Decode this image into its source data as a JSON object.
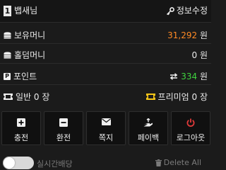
{
  "user": {
    "level": "1",
    "name": "뱁새님",
    "edit_label": "정보수정"
  },
  "balances": [
    {
      "key": "money",
      "label": "보유머니",
      "value": "31,292",
      "unit": "원",
      "icon": "coins-icon"
    },
    {
      "key": "hold",
      "label": "홀덤머니",
      "value": "0",
      "unit": "원",
      "icon": "coins-icon"
    },
    {
      "key": "point",
      "label": "포인트",
      "value": "334",
      "unit": "원",
      "icon": "point-icon",
      "icon_text": "P",
      "swap_icon": "exchange-arrows-icon"
    }
  ],
  "tickets": {
    "normal": {
      "label": "일반 0 장",
      "icon": "ticket-icon"
    },
    "premium": {
      "label": "프리미엄 0 장",
      "icon": "ticket-icon"
    }
  },
  "actions": [
    {
      "label": "충전",
      "icon": "plus-square-icon"
    },
    {
      "label": "환전",
      "icon": "minus-square-icon"
    },
    {
      "label": "쪽지",
      "icon": "envelope-icon"
    },
    {
      "label": "페이백",
      "icon": "payback-hand-icon"
    },
    {
      "label": "로그아웃",
      "icon": "power-icon"
    }
  ],
  "footer": {
    "toggle_label": "실시간배당",
    "toggle_on": false,
    "delete_label": "Delete All"
  },
  "colors": {
    "accent_orange": "#ff8a24",
    "accent_green": "#3fd33f",
    "power_red": "#e23a3a",
    "ticket_yellow": "#f5c518"
  }
}
